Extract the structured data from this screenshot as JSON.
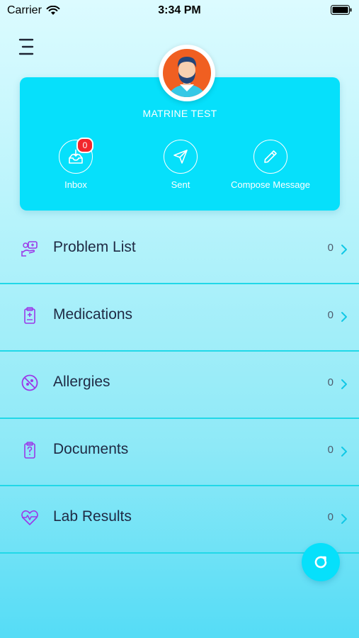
{
  "status_bar": {
    "carrier": "Carrier",
    "time": "3:34 PM"
  },
  "profile": {
    "name": "MATRINE TEST"
  },
  "actions": [
    {
      "label": "Inbox",
      "badge": "0",
      "icon": "inbox-download-icon"
    },
    {
      "label": "Sent",
      "icon": "paper-plane-icon"
    },
    {
      "label": "Compose Message",
      "icon": "pencil-icon"
    }
  ],
  "menu": [
    {
      "label": "Problem List",
      "count": "0",
      "icon": "problem-list-icon"
    },
    {
      "label": "Medications",
      "count": "0",
      "icon": "medications-icon"
    },
    {
      "label": "Allergies",
      "count": "0",
      "icon": "allergies-icon"
    },
    {
      "label": "Documents",
      "count": "0",
      "icon": "documents-icon"
    },
    {
      "label": "Lab Results",
      "count": "0",
      "icon": "heart-pulse-icon"
    }
  ],
  "colors": {
    "accent": "#06e0fb",
    "badge": "#f2262d",
    "icon_purple": "#9b39e8",
    "chevron": "#11c8e6",
    "divider": "#21d8e8"
  }
}
